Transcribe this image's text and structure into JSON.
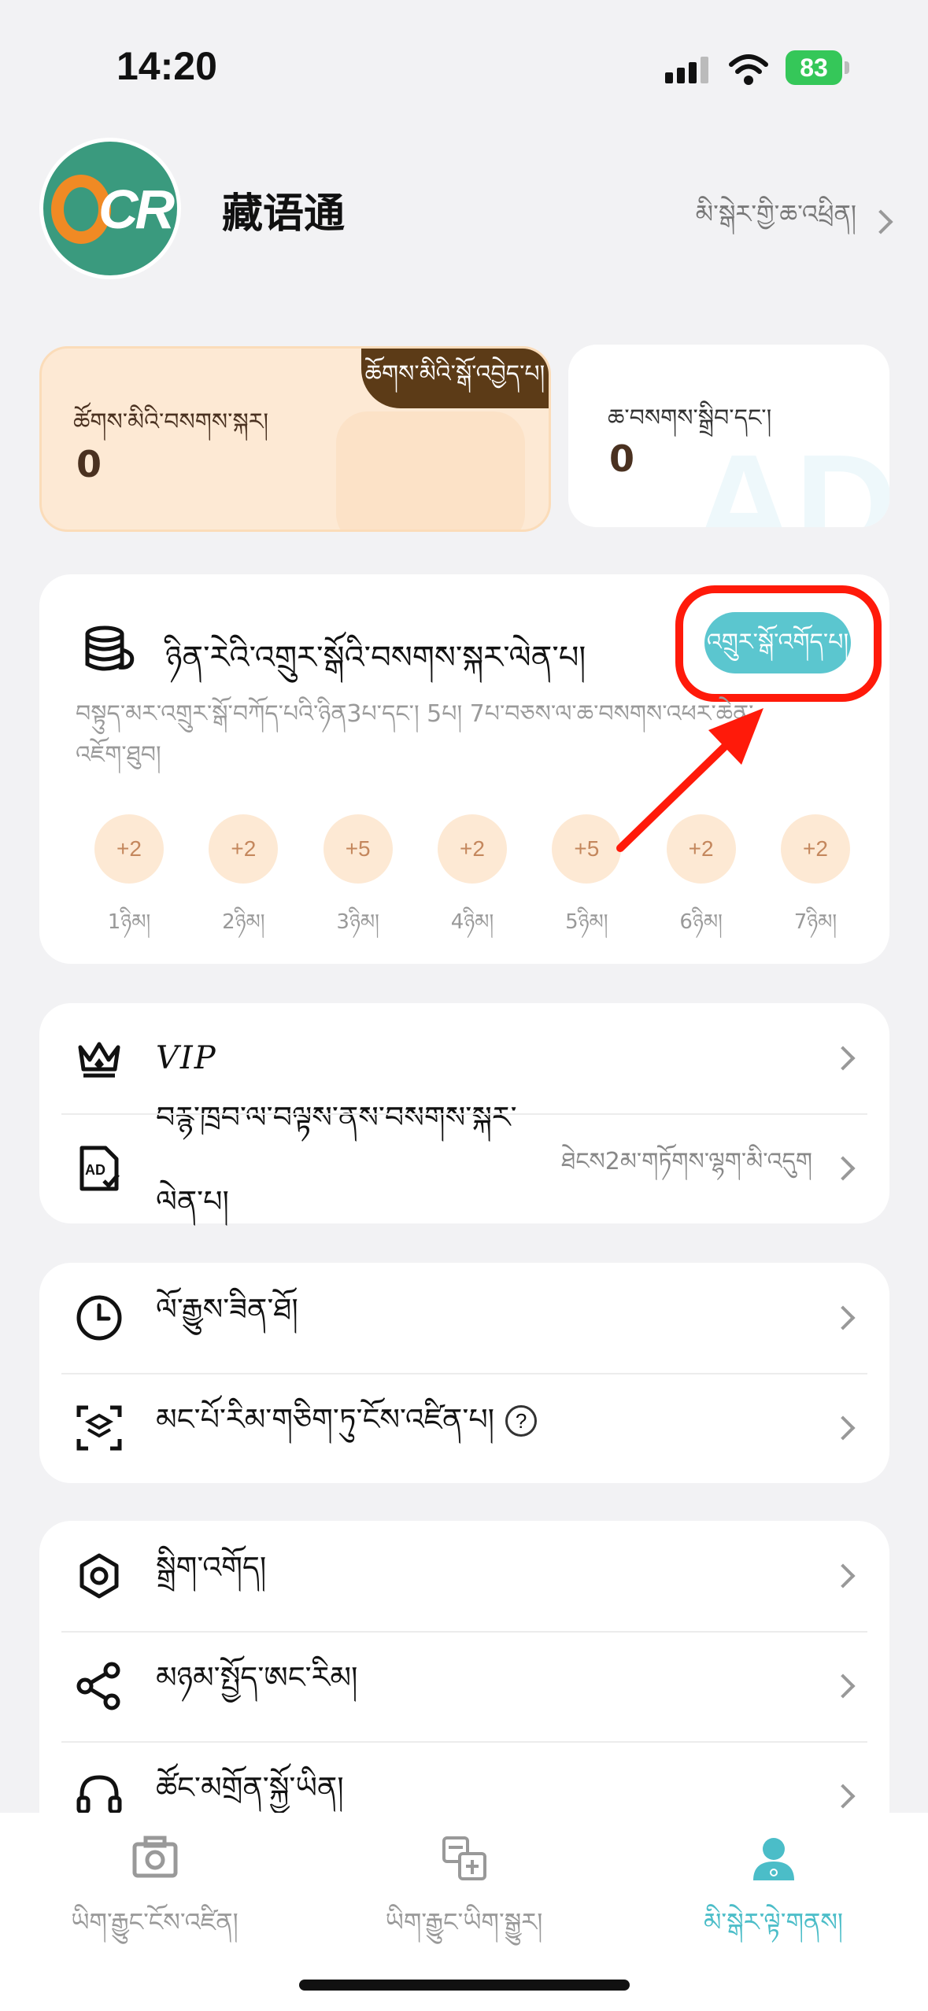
{
  "status": {
    "time": "14:20",
    "battery": "83"
  },
  "profile": {
    "avatar_letter": "O",
    "avatar_text": "CR",
    "username": "藏语通",
    "login_label": "མི་སྒེར་གྱི་ཆ་འཕྲིན།"
  },
  "points": {
    "tag": "ཆོགས་མིའི་སྒོ་འབྱེད་པ།",
    "label": "ཚོགས་མིའི་བསགས་སྐར།",
    "value": "0"
  },
  "adfree": {
    "label": "ཆ་བསགས་སྒྲིབ་དང་།",
    "value": "0",
    "watermark": "AD"
  },
  "checkin": {
    "title": "ཉིན་རེའི་འགྲུར་སྒོའི་བསགས་སྐར་ལེན་པ།",
    "button": "འགྲུར་སྒོ་འགོད་པ།",
    "description": "བསྟུད་མར་འགྲུར་སྒོ་བཀོད་པའི་ཉིན3པ་དང་། 5པ། 7པ་བཅས་ལ་ཆ་བསགས་འཕར་ཆེན་འཇོག་ཐུབ།",
    "days": [
      {
        "bonus": "+2",
        "label": "1ཉིམ།"
      },
      {
        "bonus": "+2",
        "label": "2ཉིམ།"
      },
      {
        "bonus": "+5",
        "label": "3ཉིམ།"
      },
      {
        "bonus": "+2",
        "label": "4ཉིམ།"
      },
      {
        "bonus": "+5",
        "label": "5ཉིམ།"
      },
      {
        "bonus": "+2",
        "label": "6ཉིམ།"
      },
      {
        "bonus": "+2",
        "label": "7ཉིམ།"
      }
    ]
  },
  "menu1": {
    "vip": "VIP",
    "ad_reward": "བརྙ་ཁྲབ་ལ་བལྟས་ནས་བསགས་སྐར་ལེན་པ།",
    "ad_reward_value": "ཐེངས2མ་གཏོགས་ལྷག་མི་འདུག"
  },
  "menu2": {
    "history": "ལོ་རྒྱུས་ཟིན་ཐོ།",
    "batch_ocr": "མང་པོ་རིམ་གཅིག་ཏུ་ངོས་འཛིན་པ།",
    "help_symbol": "?"
  },
  "menu3": {
    "settings": "སྒྲིག་འགོད།",
    "share": "མཉམ་སྤྱོད་ཨང་རིམ།",
    "support": "ཚོང་མགྲོན་སྐྱོ་ཡིན།"
  },
  "tabs": [
    {
      "label": "ཡིག་རྒྱུང་ངོས་འཛིན།",
      "icon": "camera-icon"
    },
    {
      "label": "ཡིག་རྒྱུང་ཡིག་སྒྱུར།",
      "icon": "translate-icon"
    },
    {
      "label": "མི་སྒེར་ལྟེ་གནས།",
      "icon": "user-icon"
    }
  ],
  "colors": {
    "accent": "#5bc6cf",
    "points_bg": "#fde9d4",
    "points_tag": "#5c3b17",
    "highlight": "#ff1a0a"
  }
}
